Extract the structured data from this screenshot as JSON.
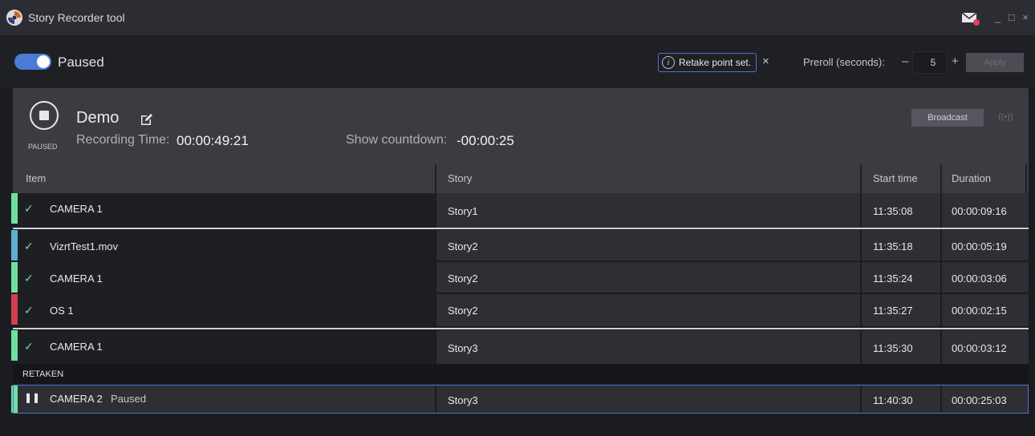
{
  "window": {
    "title": "Story Recorder tool",
    "controls": "_ □ ×"
  },
  "toolbar": {
    "toggle_label": "Paused",
    "toggle_on": true,
    "retake_notice": "Retake point set.",
    "preroll_label": "Preroll (seconds):",
    "preroll_value": "5",
    "minus": "–",
    "plus": "+",
    "apply_label": "Apply"
  },
  "session": {
    "state": "PAUSED",
    "name": "Demo",
    "recording_time_label": "Recording Time:",
    "recording_time": "00:00:49:21",
    "countdown_label": "Show countdown:",
    "countdown": "-00:00:25",
    "broadcast_label": "Broadcast",
    "broadcast_icon": "((•))"
  },
  "table": {
    "columns": [
      "Item",
      "Story",
      "Start time",
      "Duration"
    ],
    "rows": [
      {
        "item": "CAMERA 1",
        "story": "Story1",
        "start": "11:35:08",
        "duration": "00:00:09:16",
        "color": "#6fe0a0"
      },
      {
        "item": "VizrtTest1.mov",
        "story": "Story2",
        "start": "11:35:18",
        "duration": "00:00:05:19",
        "color": "#5fb0d0"
      },
      {
        "item": "CAMERA 1",
        "story": "Story2",
        "start": "11:35:24",
        "duration": "00:00:03:06",
        "color": "#6fe0a0"
      },
      {
        "item": "OS 1",
        "story": "Story2",
        "start": "11:35:27",
        "duration": "00:00:02:15",
        "color": "#d04050"
      },
      {
        "item": "CAMERA 1",
        "story": "Story3",
        "start": "11:35:30",
        "duration": "00:00:03:12",
        "color": "#6fe0a0"
      }
    ],
    "retaken_label": "RETAKEN",
    "active": {
      "item": "CAMERA 2",
      "status": "Paused",
      "story": "Story3",
      "start": "11:40:30",
      "duration": "00:00:25:03",
      "color": "#6fe0a0"
    }
  },
  "colors": {
    "accent": "#4f74d0",
    "notification": "#e0405a"
  }
}
